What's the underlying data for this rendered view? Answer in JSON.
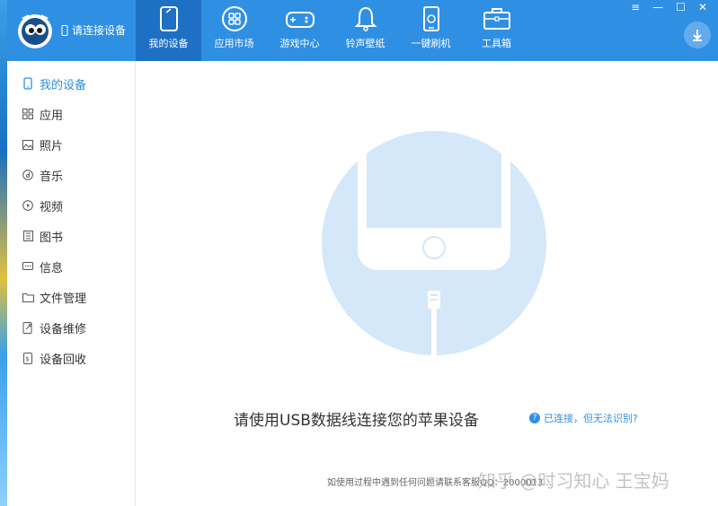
{
  "header": {
    "device_status": "请连接设备",
    "nav": [
      {
        "label": "我的设备",
        "icon": "tablet-icon",
        "active": true
      },
      {
        "label": "应用市场",
        "icon": "apps-grid-icon",
        "active": false
      },
      {
        "label": "游戏中心",
        "icon": "gamepad-icon",
        "active": false
      },
      {
        "label": "铃声壁纸",
        "icon": "bell-icon",
        "active": false
      },
      {
        "label": "一键刷机",
        "icon": "phone-refresh-icon",
        "active": false
      },
      {
        "label": "工具箱",
        "icon": "toolbox-icon",
        "active": false
      }
    ],
    "window_controls": {
      "menu": "≡",
      "minimize": "—",
      "maximize": "☐",
      "close": "✕"
    }
  },
  "sidebar": {
    "items": [
      {
        "label": "我的设备",
        "icon": "phone-icon",
        "active": true
      },
      {
        "label": "应用",
        "icon": "apps-icon",
        "active": false
      },
      {
        "label": "照片",
        "icon": "image-icon",
        "active": false
      },
      {
        "label": "音乐",
        "icon": "music-icon",
        "active": false
      },
      {
        "label": "视频",
        "icon": "play-icon",
        "active": false
      },
      {
        "label": "图书",
        "icon": "book-icon",
        "active": false
      },
      {
        "label": "信息",
        "icon": "message-icon",
        "active": false
      },
      {
        "label": "文件管理",
        "icon": "folder-icon",
        "active": false
      },
      {
        "label": "设备维修",
        "icon": "wrench-icon",
        "active": false
      },
      {
        "label": "设备回收",
        "icon": "recycle-icon",
        "active": false
      }
    ]
  },
  "main": {
    "message": "请使用USB数据线连接您的苹果设备",
    "help_link": "已连接，但无法识别?",
    "help_icon_text": "?",
    "footer_note": "如使用过程中遇到任何问题请联系客服QQ：2000013...",
    "watermark": "知乎 @时习知心 王宝妈"
  },
  "colors": {
    "header_blue": "#2f8fe3",
    "active_nav": "#1d70c4",
    "hero_circle": "#d4e8fa"
  }
}
